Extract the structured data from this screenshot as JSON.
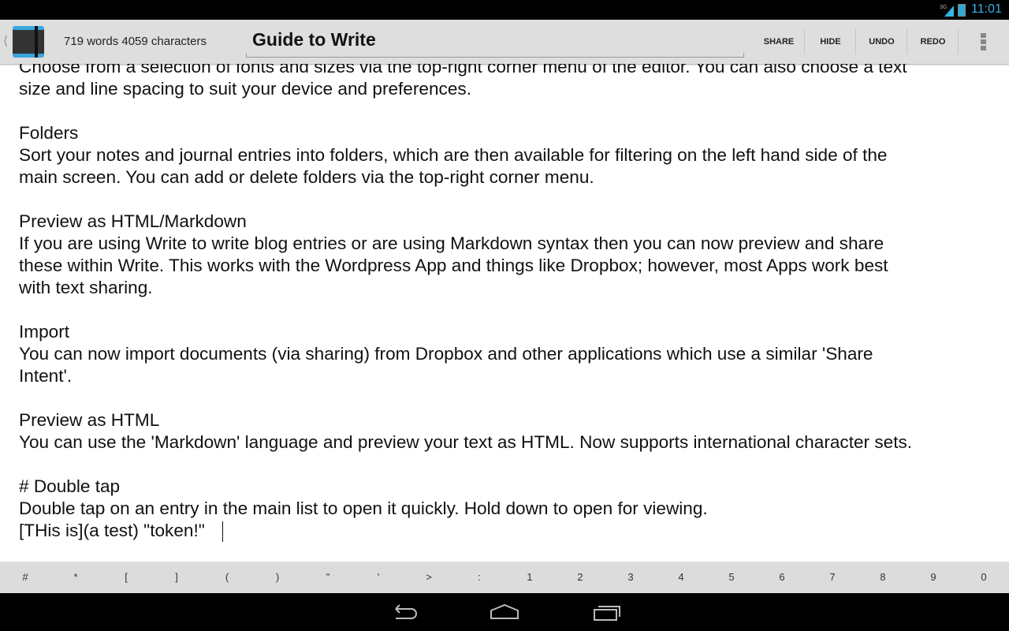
{
  "status": {
    "network": "3G",
    "time": "11:01"
  },
  "header": {
    "counts": "719 words 4059 characters",
    "title": "Guide to Write",
    "actions": [
      "SHARE",
      "HIDE",
      "UNDO",
      "REDO"
    ]
  },
  "content": {
    "lines": [
      "Choose from a selection of fonts and sizes via the top-right corner menu of the editor. You can also choose a text",
      "size and line spacing to suit your device and preferences.",
      "",
      "Folders",
      "Sort your notes and journal entries into folders, which are then available for filtering on the left hand side of the",
      "main screen. You can add or delete folders via the top-right corner menu.",
      "",
      "Preview as HTML/Markdown",
      "If you are using Write to write blog entries or are using Markdown syntax then you can now preview and share",
      "these within Write. This works with the Wordpress App and things like Dropbox; however, most Apps work best",
      "with text sharing.",
      "",
      "Import",
      "You can now import documents (via sharing) from Dropbox and other applications which use a similar 'Share",
      "Intent'.",
      "",
      "Preview as HTML",
      "You can use the 'Markdown' language and preview your text as HTML. Now supports international character sets.",
      "",
      "# Double tap",
      "Double tap on an entry in the main list to open it quickly. Hold down to open for viewing.",
      "[THis is](a test) \"token!\""
    ]
  },
  "keys": [
    "#",
    "*",
    "[",
    "]",
    "(",
    ")",
    "\"",
    "'",
    ">",
    ":",
    "1",
    "2",
    "3",
    "4",
    "5",
    "6",
    "7",
    "8",
    "9",
    "0"
  ],
  "colors": {
    "accent": "#33b5e5",
    "toolbar": "#dedede"
  }
}
